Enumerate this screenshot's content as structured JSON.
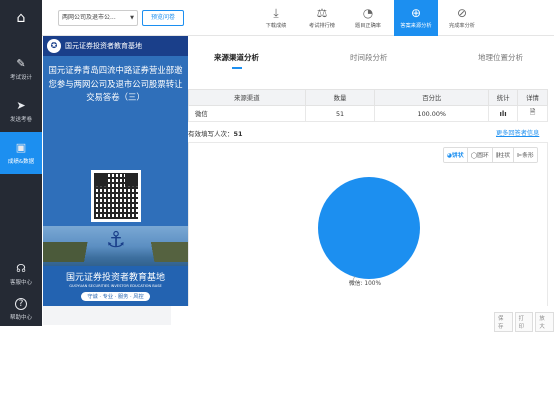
{
  "sidebar": {
    "home_icon": "home-icon",
    "items": [
      {
        "label": "考试设计",
        "icon": "edit-icon",
        "glyph": "✎"
      },
      {
        "label": "发送考卷",
        "icon": "send-icon",
        "glyph": "➤"
      },
      {
        "label": "成绩&数据",
        "icon": "chart-icon",
        "glyph": "▣"
      }
    ],
    "bottom": [
      {
        "label": "客服中心",
        "icon": "headset-icon",
        "glyph": "☊"
      },
      {
        "label": "帮助中心",
        "icon": "help-icon",
        "glyph": "?"
      }
    ]
  },
  "topbar": {
    "survey_select": "两网公司及退市公...",
    "preview_label": "预览问卷",
    "tools": [
      {
        "label": "下载成绩",
        "glyph": "⤓"
      },
      {
        "label": "考试排行榜",
        "glyph": "⚖"
      },
      {
        "label": "题目正确率",
        "glyph": "◔"
      },
      {
        "label": "答案来源分析",
        "glyph": "⊕"
      },
      {
        "label": "完成率分析",
        "glyph": "⊘"
      }
    ]
  },
  "overlay": {
    "brand": "国元证券投资者教育基地",
    "title": "国元证券青岛四流中路证券营业部邀您参与两网公司及退市公司股票转让交易答卷（三）",
    "footer_cn": "国元证券投资者教育基地",
    "footer_en": "GUOYUAN SECURITIES INVESTOR EDUCATION BASE",
    "slogan": "守诚 · 专业 · 服务 · 风控"
  },
  "tabs": [
    {
      "label": "来源渠道分析"
    },
    {
      "label": "时间段分析"
    },
    {
      "label": "地理位置分析"
    }
  ],
  "table": {
    "headers": [
      "来源渠道",
      "数量",
      "百分比",
      "统计",
      "详情"
    ],
    "rows": [
      {
        "channel": "微信",
        "count": "51",
        "percent": "100.00%"
      }
    ]
  },
  "valid_count_label": "有效填写人次：",
  "valid_count_value": "51",
  "more_link": "更多回答者信息",
  "chart_types": [
    "◕饼状",
    "◯圆环",
    "⫼柱状",
    "⊫条形"
  ],
  "chart_data": {
    "type": "pie",
    "slices": [
      {
        "label": "微信",
        "value": 100,
        "percent_label": "微信: 100%",
        "color": "#1c8ff0"
      }
    ]
  },
  "footer_buttons": [
    "保存",
    "打印",
    "放大"
  ]
}
